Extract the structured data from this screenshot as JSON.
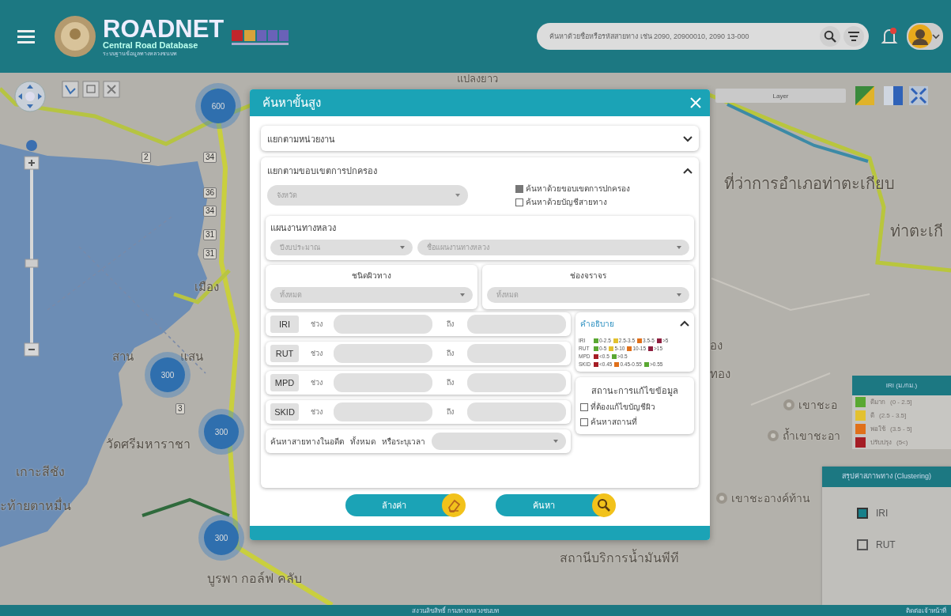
{
  "header": {
    "brand": "ROADNET",
    "subtitle": "Central Road Database",
    "caption": "ระบบฐานข้อมูลทางหลวงชนบท",
    "search": {
      "placeholder": "ค้นหาด้วยชื่อหรือรหัสสายทาง เช่น 2090, 20900010, 2090 13-000"
    }
  },
  "map": {
    "layer_select": {
      "value": "Layer"
    },
    "labels": [
      {
        "text": "แปลงยาว",
        "kind": "place"
      },
      {
        "text": "ที่ว่าการอำเภอท่าตะเกียบ",
        "kind": "place"
      },
      {
        "text": "ท่าตะเกี",
        "kind": "place"
      },
      {
        "text": "อง",
        "kind": "place"
      },
      {
        "text": "ทอง",
        "kind": "place"
      },
      {
        "text": "เขาชะอ",
        "kind": "poi"
      },
      {
        "text": "ถ้ำเขาชะอา",
        "kind": "poi"
      },
      {
        "text": "เขาชะอางค์ท้าน",
        "kind": "poi"
      },
      {
        "text": "สถานีบริการน้ำมันพีที",
        "kind": "place"
      },
      {
        "text": "บูรพา กอล์ฟ คลับ",
        "kind": "place"
      },
      {
        "text": "เมือง",
        "kind": "place"
      },
      {
        "text": "สาน",
        "kind": "place"
      },
      {
        "text": "แสน",
        "kind": "place"
      },
      {
        "text": "วัดศรีมหาราชา",
        "kind": "place"
      },
      {
        "text": "เกาะสีชัง",
        "kind": "place"
      },
      {
        "text": "ะท้ายตาหมื่น",
        "kind": "place"
      },
      {
        "text": "2",
        "kind": "shield"
      },
      {
        "text": "34",
        "kind": "shield"
      },
      {
        "text": "36",
        "kind": "shield"
      },
      {
        "text": "34",
        "kind": "shield"
      },
      {
        "text": "31",
        "kind": "shield"
      },
      {
        "text": "31",
        "kind": "shield"
      },
      {
        "text": "3",
        "kind": "shield"
      }
    ],
    "clusters": [
      {
        "count": "600"
      },
      {
        "count": "300"
      },
      {
        "count": "300"
      },
      {
        "count": "300"
      }
    ],
    "iri_legend": {
      "title": "IRI (ม./กม.)",
      "rows": [
        {
          "color": "#5aa832",
          "label": "ดีมาก",
          "range": "(0 - 2.5]"
        },
        {
          "color": "#e3c12f",
          "label": "ดี",
          "range": "(2.5 - 3.5]"
        },
        {
          "color": "#e0701a",
          "label": "พอใช้",
          "range": "(3.5 - 5]"
        },
        {
          "color": "#a51d25",
          "label": "ปรับปรุง",
          "range": "(5<)"
        }
      ]
    },
    "clustering": {
      "title": "สรุปค่าสภาพทาง (Clustering)",
      "options": [
        {
          "label": "IRI",
          "checked": true
        },
        {
          "label": "RUT",
          "checked": false
        }
      ]
    }
  },
  "modal": {
    "title": "ค้นหาขั้นสูง",
    "sections": [
      {
        "title": "แยกตามหน่วยงาน",
        "expanded": false
      },
      {
        "title": "แยกตามขอบเขตการปกครอง",
        "expanded": true
      }
    ],
    "province_select": {
      "placeholder": "จังหวัด"
    },
    "search_modes": [
      {
        "label": "ค้นหาด้วยขอบเขตการปกครอง",
        "checked": true
      },
      {
        "label": "ค้นหาด้วยบัญชีสายทาง",
        "checked": false
      }
    ],
    "plan": {
      "title": "แผนงานทางหลวง",
      "selects": [
        {
          "placeholder": "ปีงบประมาณ"
        },
        {
          "placeholder": "ชื่อแผนงานทางหลวง"
        }
      ]
    },
    "filters": [
      {
        "title": "ชนิดผิวทาง",
        "placeholder": "ทั้งหมด"
      },
      {
        "title": "ช่องจราจร",
        "placeholder": "ทั้งหมด"
      }
    ],
    "ranges": [
      {
        "name": "IRI",
        "from": "ช่วง",
        "to": "ถึง"
      },
      {
        "name": "RUT",
        "from": "ช่วง",
        "to": "ถึง"
      },
      {
        "name": "MPD",
        "from": "ช่วง",
        "to": "ถึง"
      },
      {
        "name": "SKID",
        "from": "ช่วง",
        "to": "ถึง"
      }
    ],
    "history": {
      "label": "ค้นหาสายทางในอดีต",
      "all": "ทั้งหมด",
      "specify": "หรือระบุเวลา"
    },
    "legend": {
      "title": "คำอธิบาย",
      "expanded": true,
      "rows": [
        {
          "name": "IRI",
          "items": [
            {
              "color": "#5aa832",
              "label": "0-2.5"
            },
            {
              "color": "#e3c12f",
              "label": "2.5-3.5"
            },
            {
              "color": "#e0701a",
              "label": "3.5-5"
            },
            {
              "color": "#8e1f3f",
              "label": ">5"
            }
          ]
        },
        {
          "name": "RUT",
          "items": [
            {
              "color": "#5aa832",
              "label": "0-5"
            },
            {
              "color": "#e3c12f",
              "label": "5-10"
            },
            {
              "color": "#e0701a",
              "label": "10-15"
            },
            {
              "color": "#8e1f3f",
              "label": ">15"
            }
          ]
        },
        {
          "name": "MPD",
          "items": [
            {
              "color": "#a51d25",
              "label": "<0.5"
            },
            {
              "color": "#5aa832",
              "label": ">0.5"
            }
          ]
        },
        {
          "name": "SKID",
          "items": [
            {
              "color": "#a51d25",
              "label": "<0.45"
            },
            {
              "color": "#e0701a",
              "label": "0.45-0.55"
            },
            {
              "color": "#5aa832",
              "label": ">0.55"
            }
          ]
        }
      ]
    },
    "status": {
      "title": "สถานะการแก้ไขข้อมูล",
      "options": [
        {
          "label": "ที่ต้องแก้ไขบัญชีผิว",
          "checked": false
        },
        {
          "label": "ค้นหาสถานที่",
          "checked": false
        }
      ]
    },
    "buttons": [
      {
        "label": "ล้างค่า",
        "kind": "clear"
      },
      {
        "label": "ค้นหา",
        "kind": "search"
      }
    ]
  },
  "footer": {
    "center": "สงวนลิขสิทธิ์ กรมทางหลวงชนบท",
    "right": "ติดต่อเจ้าหน้าที่"
  }
}
